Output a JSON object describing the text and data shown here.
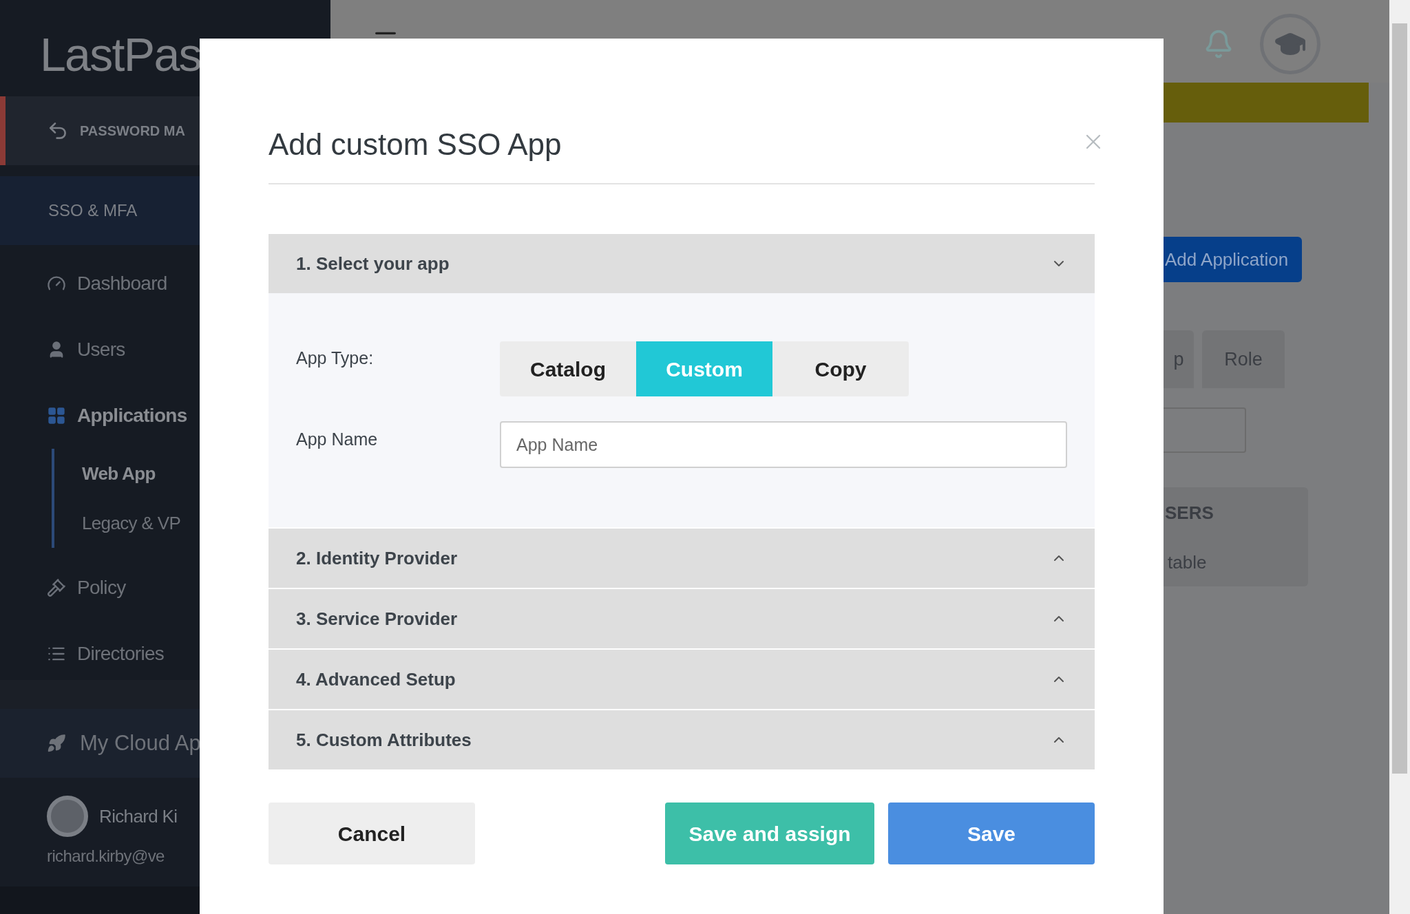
{
  "sidebar": {
    "logo": "LastPas",
    "back_item": "PASSWORD MA",
    "section": "SSO & MFA",
    "items": [
      {
        "label": "Dashboard",
        "selected": false
      },
      {
        "label": "Users",
        "selected": false
      },
      {
        "label": "Applications",
        "selected": true,
        "children": [
          {
            "label": "Web App",
            "selected": true
          },
          {
            "label": "Legacy & VP",
            "selected": false
          }
        ]
      },
      {
        "label": "Policy",
        "selected": false
      },
      {
        "label": "Directories",
        "selected": false
      }
    ],
    "cloud_apps": "My Cloud Ap",
    "user_name": "Richard Ki",
    "user_email": "richard.kirby@ve"
  },
  "background": {
    "add_button": "Add Application",
    "tabs": [
      {
        "label": "p"
      },
      {
        "label": "Role"
      }
    ],
    "table_header": "SERS",
    "table_text": "table"
  },
  "modal": {
    "title": "Add custom SSO App",
    "sections": [
      {
        "title": "1. Select your app",
        "expanded": true
      },
      {
        "title": "2. Identity Provider",
        "expanded": false
      },
      {
        "title": "3. Service Provider",
        "expanded": false
      },
      {
        "title": "4. Advanced Setup",
        "expanded": false
      },
      {
        "title": "5. Custom Attributes",
        "expanded": false
      }
    ],
    "app_type_label": "App Type:",
    "app_types": [
      {
        "label": "Catalog",
        "selected": false
      },
      {
        "label": "Custom",
        "selected": true
      },
      {
        "label": "Copy",
        "selected": false
      }
    ],
    "app_name_label": "App Name",
    "app_name_placeholder": "App Name",
    "buttons": [
      {
        "label": "Cancel",
        "kind": "cancel"
      },
      {
        "label": "Save and assign",
        "kind": "assign"
      },
      {
        "label": "Save",
        "kind": "save"
      }
    ]
  }
}
